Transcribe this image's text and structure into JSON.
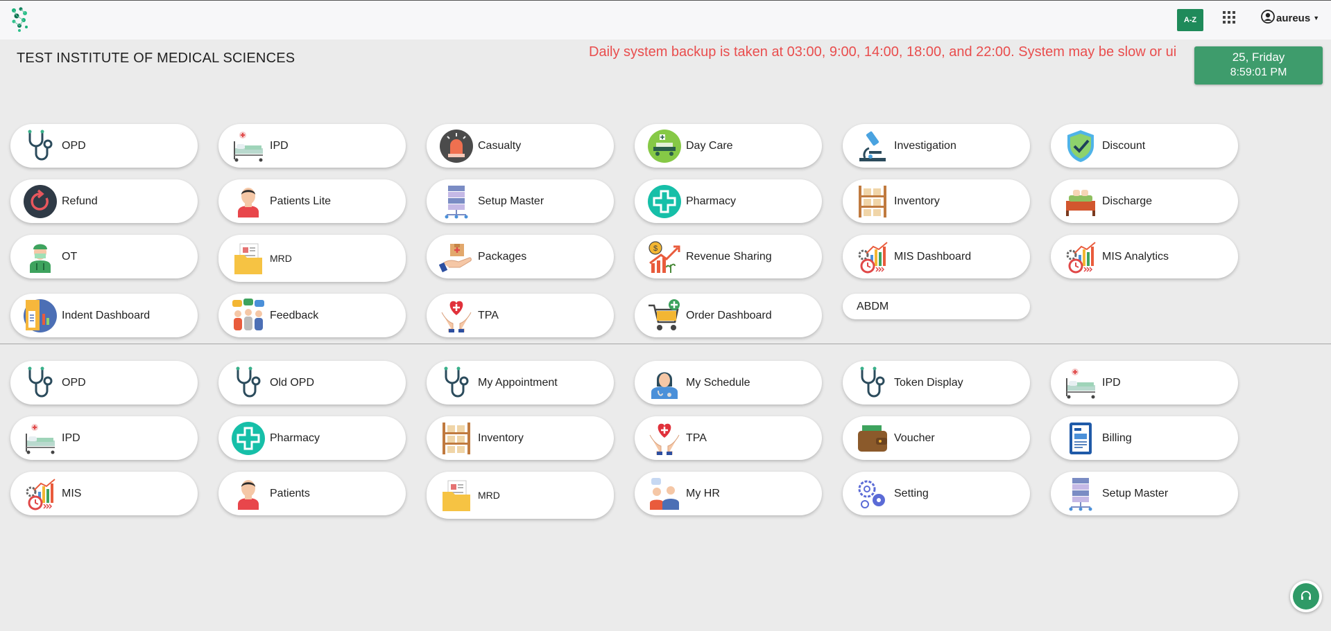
{
  "header": {
    "az_label": "A-Z",
    "username": "aureus"
  },
  "institute_name": "TEST INSTITUTE OF MEDICAL SCIENCES",
  "notice": "Daily system backup is taken at 03:00, 9:00, 14:00, 18:00, and 22:00. System may be slow or ui",
  "datetime": {
    "date": "25, Friday",
    "time": "8:59:01 PM"
  },
  "modules": [
    {
      "label": "OPD",
      "icon": "stethoscope-icon"
    },
    {
      "label": "IPD",
      "icon": "hospital-bed-icon"
    },
    {
      "label": "Casualty",
      "icon": "siren-icon"
    },
    {
      "label": "Day Care",
      "icon": "day-care-bed-icon"
    },
    {
      "label": "Investigation",
      "icon": "microscope-icon"
    },
    {
      "label": "Discount",
      "icon": "shield-check-icon"
    },
    {
      "label": "Refund",
      "icon": "refund-icon"
    },
    {
      "label": "Patients Lite",
      "icon": "patient-icon"
    },
    {
      "label": "Setup Master",
      "icon": "server-icon"
    },
    {
      "label": "Pharmacy",
      "icon": "medical-cross-icon"
    },
    {
      "label": "Inventory",
      "icon": "shelf-icon"
    },
    {
      "label": "Discharge",
      "icon": "discharge-bed-icon"
    },
    {
      "label": "OT",
      "icon": "surgeon-icon"
    },
    {
      "label": "MRD",
      "icon": "folder-icon"
    },
    {
      "label": "Packages",
      "icon": "package-hand-icon"
    },
    {
      "label": "Revenue Sharing",
      "icon": "revenue-growth-icon"
    },
    {
      "label": "MIS Dashboard",
      "icon": "analytics-icon"
    },
    {
      "label": "MIS Analytics",
      "icon": "analytics-icon"
    },
    {
      "label": "Indent Dashboard",
      "icon": "indent-icon"
    },
    {
      "label": "Feedback",
      "icon": "feedback-people-icon"
    },
    {
      "label": "TPA",
      "icon": "heart-hands-icon"
    },
    {
      "label": "Order Dashboard",
      "icon": "cart-icon"
    },
    {
      "label": "ABDM",
      "icon": ""
    }
  ],
  "quick_links": [
    {
      "label": "OPD",
      "icon": "stethoscope-icon"
    },
    {
      "label": "Old OPD",
      "icon": "stethoscope-icon"
    },
    {
      "label": "My Appointment",
      "icon": "stethoscope-icon"
    },
    {
      "label": "My Schedule",
      "icon": "doctor-icon"
    },
    {
      "label": "Token Display",
      "icon": "stethoscope-icon"
    },
    {
      "label": "IPD",
      "icon": "hospital-bed-icon"
    },
    {
      "label": "IPD",
      "icon": "hospital-bed-icon"
    },
    {
      "label": "Pharmacy",
      "icon": "medical-cross-icon"
    },
    {
      "label": "Inventory",
      "icon": "shelf-icon"
    },
    {
      "label": "TPA",
      "icon": "heart-hands-icon"
    },
    {
      "label": "Voucher",
      "icon": "wallet-icon"
    },
    {
      "label": "Billing",
      "icon": "invoice-icon"
    },
    {
      "label": "MIS",
      "icon": "analytics-icon"
    },
    {
      "label": "Patients",
      "icon": "patient-icon"
    },
    {
      "label": "MRD",
      "icon": "folder-icon"
    },
    {
      "label": "My HR",
      "icon": "hr-people-icon"
    },
    {
      "label": "Setting",
      "icon": "gears-icon"
    },
    {
      "label": "Setup Master",
      "icon": "server-icon"
    }
  ]
}
